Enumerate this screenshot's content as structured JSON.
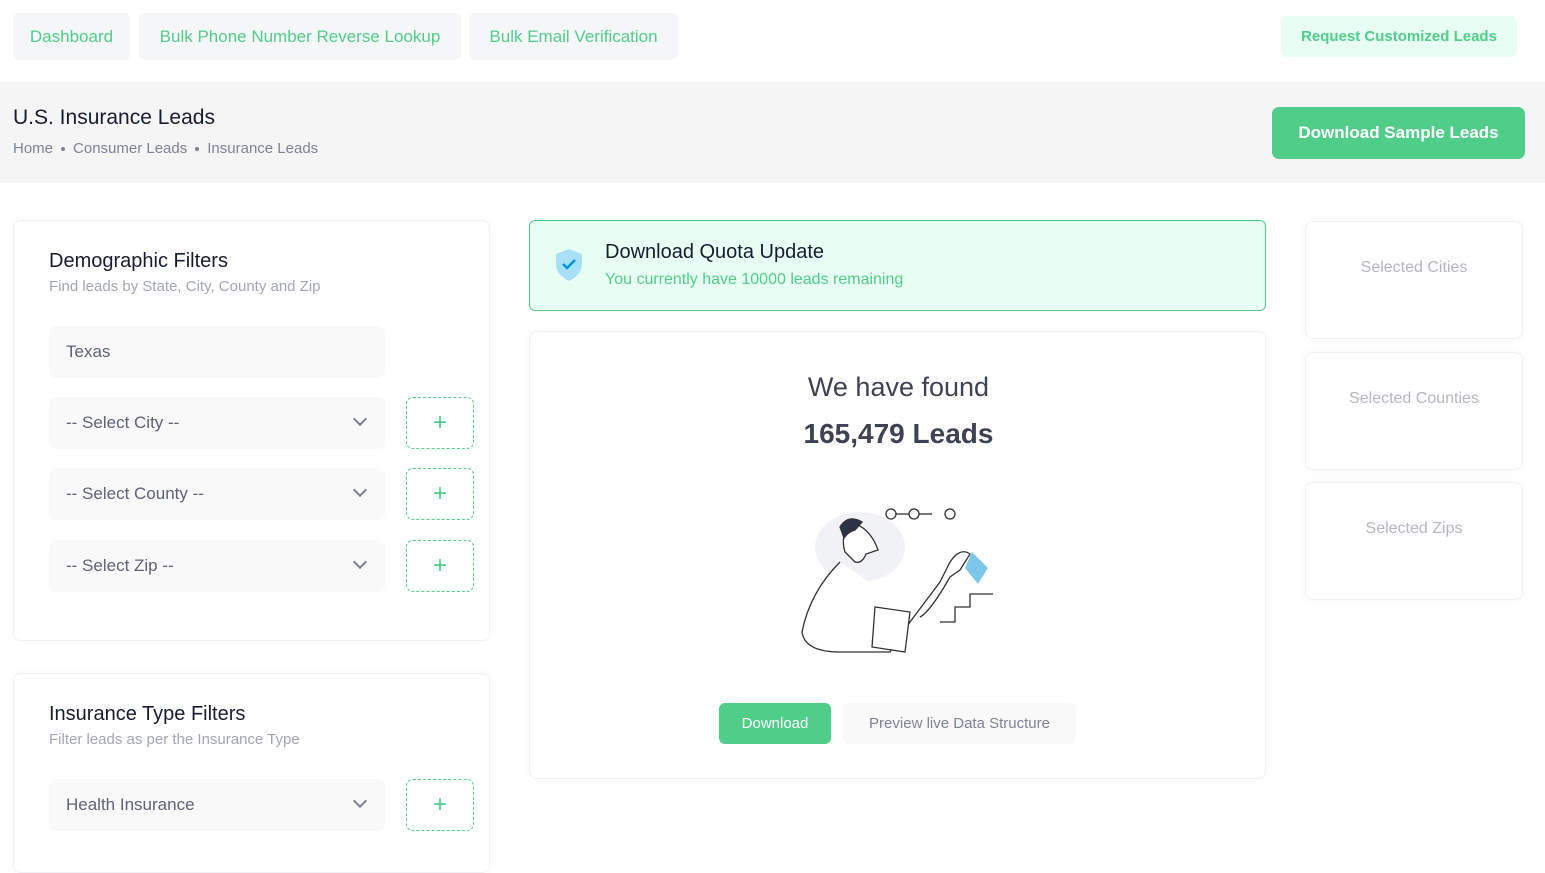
{
  "nav": {
    "items": [
      "Dashboard",
      "Bulk Phone Number Reverse Lookup",
      "Bulk Email Verification"
    ],
    "request": "Request Customized Leads"
  },
  "header": {
    "title": "U.S. Insurance Leads",
    "breadcrumb": [
      "Home",
      "Consumer Leads",
      "Insurance Leads"
    ],
    "download_sample": "Download Sample Leads"
  },
  "demographic": {
    "title": "Demographic Filters",
    "subtitle": "Find leads by State, City, County and Zip",
    "state": "Texas",
    "city": "-- Select City --",
    "county": "-- Select County --",
    "zip": "-- Select Zip --",
    "add": "+"
  },
  "insurance": {
    "title": "Insurance Type Filters",
    "subtitle": "Filter leads as per the Insurance Type",
    "type": "Health Insurance",
    "add": "+"
  },
  "quota": {
    "title": "Download Quota Update",
    "message": "You currently have 10000 leads remaining",
    "icon": "shield-check-icon"
  },
  "results": {
    "heading": "We have found",
    "count": "165,479 Leads",
    "download": "Download",
    "preview": "Preview live Data Structure"
  },
  "selected": {
    "cities": "Selected Cities",
    "counties": "Selected Counties",
    "zips": "Selected Zips"
  },
  "colors": {
    "accent": "#50cd89",
    "accent_light": "#e8fff3"
  }
}
